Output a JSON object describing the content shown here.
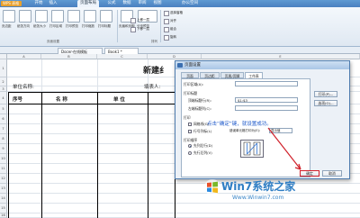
{
  "app": {
    "name": "WPS 表格"
  },
  "menu": [
    "开始",
    "插入",
    "页面布局",
    "公式",
    "数据",
    "审阅",
    "视图",
    "办公空间"
  ],
  "menu_active_index": 2,
  "ribbon": {
    "group_label": "页面设置",
    "group_label2": "排列",
    "buttons": [
      "页边距",
      "纸张方向",
      "纸张大小",
      "打印区域",
      "打印预览",
      "打印缩放",
      "打印标题",
      "页眉和页脚",
      "分页预览",
      "插入分页符"
    ],
    "right_items": [
      "上移一层",
      "下移一层",
      "选择窗格",
      "对齐",
      "组合",
      "旋转"
    ]
  },
  "doc_tabs": [
    "Docer-在线模板",
    "Book1 *"
  ],
  "sheet": {
    "title_fragment": "新建纟",
    "unit_label": "单位名称:",
    "filler_label": "填表人:",
    "headers": [
      "序号",
      "名  称",
      "单  位"
    ],
    "col_headers": [
      "A",
      "B",
      "C",
      "D",
      "E"
    ],
    "row_headers": [
      "1",
      "2",
      "3",
      "4",
      "5",
      "6",
      "7",
      "8",
      "9",
      "10",
      "11",
      "12",
      "13",
      "14",
      "15",
      "16",
      "17",
      "18",
      "19"
    ]
  },
  "dialog": {
    "title": "页面设置",
    "tabs": [
      "页面",
      "页边距",
      "页眉/页脚",
      "工作表"
    ],
    "active_tab": 3,
    "print_area_label": "打印区域(A):",
    "print_title_label": "打印标题",
    "top_rows_label": "顶端标题行(R):",
    "top_rows_value": "$1:$3",
    "left_cols_label": "左端标题列(C):",
    "print_label": "打印",
    "gridlines_label": "网格线(G)",
    "rowcol_label": "行号列标(L)",
    "errors_label": "错误单元格打印为(E):",
    "errors_value": "显示值",
    "order_label": "打印顺序",
    "order_down": "先列后行(D)",
    "order_over": "先行后列(V)",
    "btn_print": "打印(P)...",
    "btn_options": "选项(O)...",
    "btn_ok": "确定",
    "btn_cancel": "取消",
    "annotation": "点击“确定”键，就设置成功。"
  },
  "watermark": {
    "brand": "Win7系统之家",
    "url": "Www.Winwin7.com"
  },
  "colors": {
    "accent": "#4a80c0",
    "annotation": "#1a56c9",
    "arrow": "#d0202a"
  }
}
